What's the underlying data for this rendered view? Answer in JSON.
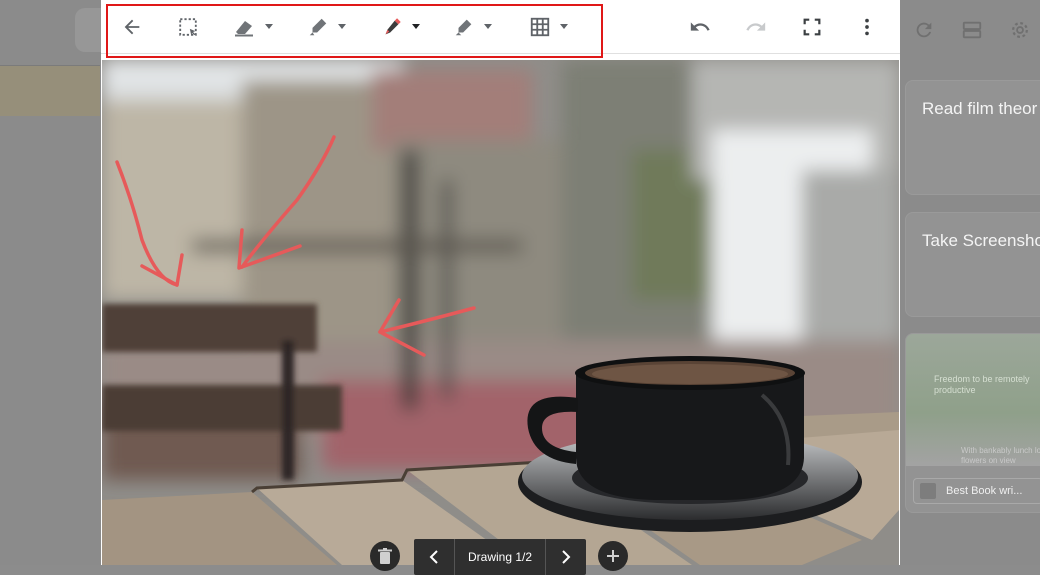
{
  "colors": {
    "accent_highlight": "#e01818",
    "ink_red": "#e65a5a",
    "overlay_gray": "#8b8b8b"
  },
  "toolbar": {
    "icons": [
      "back-arrow-icon",
      "select-area-icon",
      "eraser-icon",
      "marker-icon",
      "pen-icon",
      "highlighter-icon",
      "grid-icon",
      "undo-icon",
      "redo-icon",
      "fullscreen-icon",
      "more-vert-icon"
    ]
  },
  "background": {
    "cards": [
      {
        "title": "Read film theor"
      },
      {
        "title": "Take Screensho"
      }
    ],
    "thumb_card": {
      "headline": "Freedom to be remotely productive",
      "caption": "With bankably lunch low flowers on view",
      "chip_label": "Best Book wri..."
    }
  },
  "pager": {
    "label": "Drawing 1/2"
  }
}
